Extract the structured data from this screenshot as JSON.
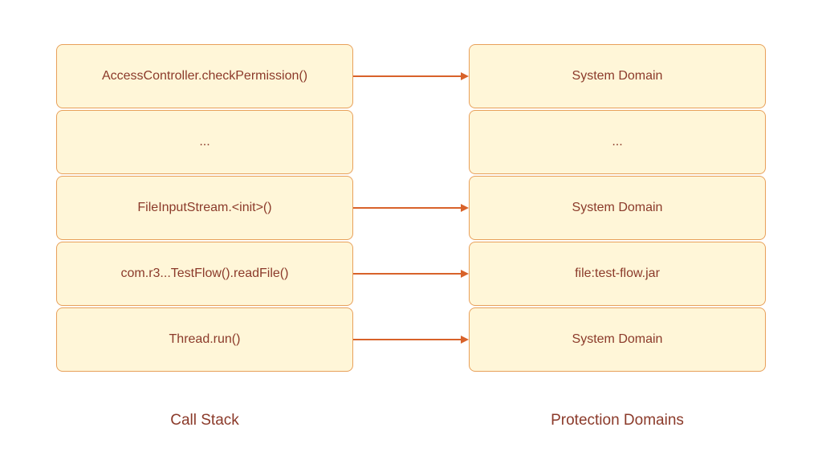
{
  "left_column": {
    "label": "Call Stack",
    "items": [
      "AccessController.checkPermission()",
      "...",
      "FileInputStream.<init>()",
      "com.r3...TestFlow().readFile()",
      "Thread.run()"
    ]
  },
  "right_column": {
    "label": "Protection Domains",
    "items": [
      "System Domain",
      "...",
      "System Domain",
      "file:test-flow.jar",
      "System Domain"
    ]
  },
  "arrows": [
    {
      "row": 0,
      "visible": true
    },
    {
      "row": 1,
      "visible": false
    },
    {
      "row": 2,
      "visible": true
    },
    {
      "row": 3,
      "visible": true
    },
    {
      "row": 4,
      "visible": true
    }
  ],
  "colors": {
    "box_bg": "#fff6d8",
    "box_border": "#e8a05a",
    "text": "#8b3a2a",
    "arrow": "#d8622a"
  }
}
